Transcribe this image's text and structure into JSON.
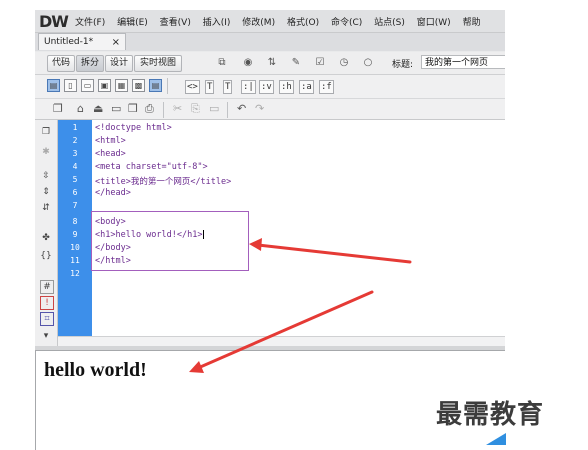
{
  "app": {
    "logo": "DW",
    "menus": [
      "文件(F)",
      "编辑(E)",
      "查看(V)",
      "插入(I)",
      "修改(M)",
      "格式(O)",
      "命令(C)",
      "站点(S)",
      "窗口(W)",
      "帮助"
    ]
  },
  "document_tab": {
    "name": "Untitled-1*",
    "close": "×"
  },
  "view_bar": {
    "buttons": [
      {
        "label": "代码",
        "active": false
      },
      {
        "label": "拆分",
        "active": true
      },
      {
        "label": "设计",
        "active": false
      },
      {
        "label": "实时视图",
        "active": false
      }
    ],
    "title_label": "标题:",
    "title_value": "我的第一个网页"
  },
  "toolbar3": {
    "tags": [
      "<>",
      "T",
      "T",
      ":|",
      ":v",
      ":h",
      ":a",
      ":f"
    ]
  },
  "editor": {
    "line_numbers": [
      "1",
      "2",
      "3",
      "4",
      "5",
      "6",
      "7",
      "8",
      "9",
      "10",
      "11",
      "12"
    ],
    "lines": [
      "<!doctype html>",
      "<html>",
      "<head>",
      "<meta charset=\"utf-8\">",
      "<title>我的第一个网页</title>",
      "</head>",
      "",
      "<body>",
      "<h1>hello world!</h1>",
      "</body>",
      "</html>",
      ""
    ]
  },
  "design_view": {
    "heading": "hello world!"
  },
  "watermark": "最需教育",
  "colors": {
    "gutter": "#3d8fea",
    "arrow": "#e53a35",
    "highlight_box": "#a35fbd"
  }
}
